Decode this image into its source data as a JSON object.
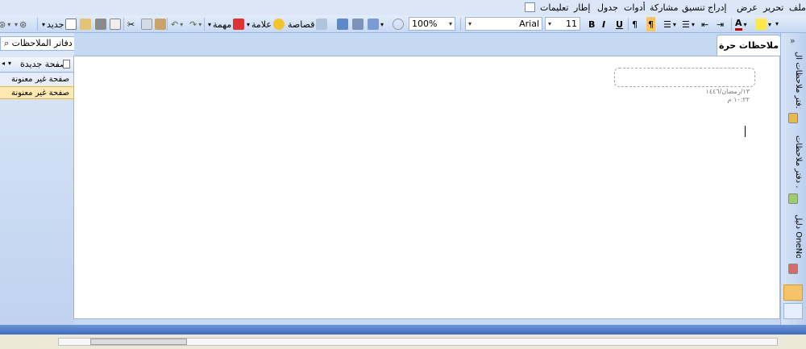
{
  "menubar": {
    "items": [
      "ملف",
      "تحرير",
      "عرض",
      "إدراج",
      "تنسيق",
      "مشاركة",
      "أدوات",
      "جدول",
      "إطار",
      "تعليمات"
    ]
  },
  "toolbar": {
    "new_label": "جديد",
    "task_label": "مهمة",
    "tag_label": "علامة",
    "clipping_label": "قصاصة",
    "zoom_value": "100%",
    "font_value": "Arial",
    "size_value": "11",
    "bold": "B",
    "italic": "I",
    "underline": "U"
  },
  "sidebar": {
    "search_text": "البحث في كافة دفاتر الملاحظات",
    "new_page_label": "صفحة جديدة",
    "pages": [
      "صفحة غير معنونة",
      "صفحة غير معنونة"
    ]
  },
  "main": {
    "section_tab": "ملاحظات حرة",
    "page_date": "١٣/رمضان/١٤٤٦",
    "page_time": "١٠:٢٢ م",
    "cursor_char": "I"
  },
  "notebooks": {
    "expand_label": "»",
    "items": [
      "دفتر ملاحظات ال...",
      "دفتر ملاحظات ...",
      "دليل OneNot..."
    ],
    "colors": [
      "#e8b84a",
      "#9ccf6a",
      "#d56b6b"
    ]
  },
  "colors": {
    "accent": "#3f6cbf",
    "selected_page": "#ffe9b0"
  }
}
